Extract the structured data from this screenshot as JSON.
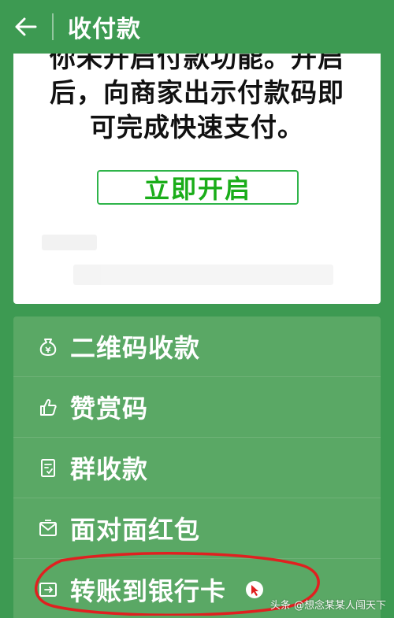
{
  "header": {
    "title": "收付款"
  },
  "card": {
    "notice_lines": [
      "你未开启付款功能。开启",
      "后，向商家出示付款码即",
      "可完成快速支付。"
    ],
    "enable_button": "立即开启"
  },
  "menu": {
    "items": [
      {
        "label": "二维码收款",
        "icon": "money-bag-icon"
      },
      {
        "label": "赞赏码",
        "icon": "thumbs-up-icon"
      },
      {
        "label": "群收款",
        "icon": "group-bill-icon"
      },
      {
        "label": "面对面红包",
        "icon": "red-envelope-icon"
      },
      {
        "label": "转账到银行卡",
        "icon": "bank-transfer-icon"
      }
    ]
  },
  "watermark": "头条 @想念某某人闯天下",
  "colors": {
    "header_bg": "#3d9a52",
    "menu_bg": "#5aa865",
    "accent_green": "#1aad19",
    "annotation_red": "#e02020"
  }
}
